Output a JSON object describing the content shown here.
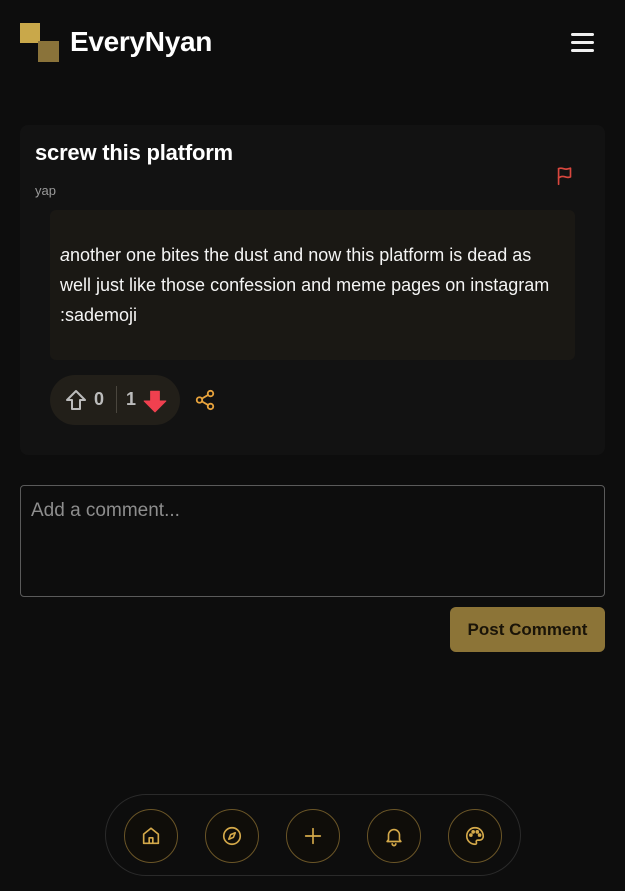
{
  "header": {
    "brand": "EveryNyan",
    "menu_icon": "hamburger-menu-icon"
  },
  "post": {
    "title": "screw this platform",
    "tag": "yap",
    "body_first_char": "a",
    "body_rest": "nother one bites the dust and now this platform is dead as well just like those confession and meme pages on instagram :sademoji",
    "upvotes": "0",
    "downvotes": "1",
    "flag_icon": "flag-icon",
    "share_icon": "share-icon"
  },
  "comment": {
    "placeholder": "Add a comment...",
    "submit_label": "Post Comment"
  },
  "bottom_nav": {
    "items": [
      {
        "icon": "home-icon"
      },
      {
        "icon": "compass-icon"
      },
      {
        "icon": "plus-icon"
      },
      {
        "icon": "bell-icon"
      },
      {
        "icon": "palette-icon"
      }
    ]
  },
  "colors": {
    "background": "#0d0d0d",
    "card": "#121212",
    "accent_gold": "#c9a84a",
    "button_gold": "#8c7437",
    "flag_red": "#d9473e",
    "downvote_red": "#f0404f",
    "share_orange": "#e8a33c"
  }
}
